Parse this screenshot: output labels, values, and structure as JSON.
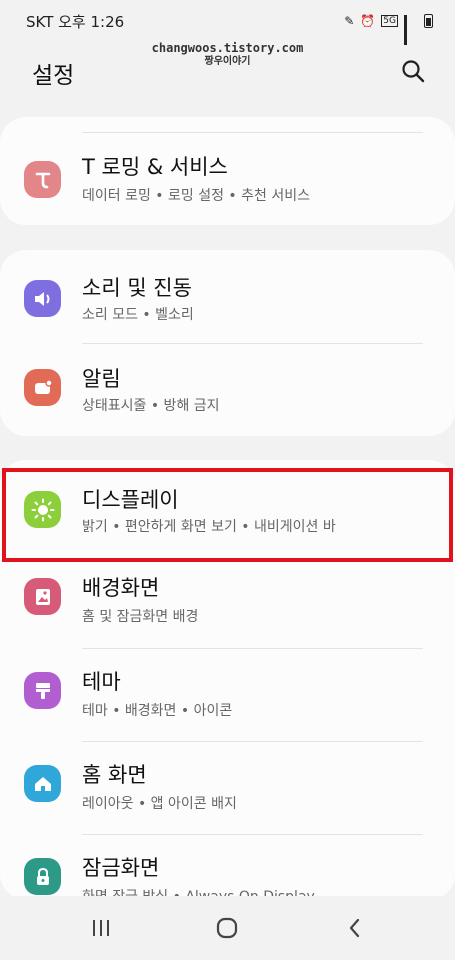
{
  "status": {
    "carrier_time": "SKT 오후 1:26",
    "network": "5G"
  },
  "watermark": {
    "line1": "changwoos.tistory.com",
    "line2": "짱우이야기"
  },
  "header": {
    "title": "설정",
    "search_icon": "search-icon"
  },
  "groups": [
    {
      "items": [
        {
          "label": "T 로밍 & 서비스",
          "sub": "데이터 로밍 • 로밍 설정 • 추천 서비스",
          "icon": "roaming-icon",
          "icon_color": "#e3868a"
        }
      ]
    },
    {
      "items": [
        {
          "label": "소리 및 진동",
          "sub": "소리 모드 • 벨소리",
          "icon": "speaker-icon",
          "icon_color": "#7d6fe0"
        },
        {
          "label": "알림",
          "sub": "상태표시줄 • 방해 금지",
          "icon": "notification-icon",
          "icon_color": "#e26b58"
        }
      ]
    },
    {
      "items": [
        {
          "label": "디스플레이",
          "sub": "밝기 • 편안하게 화면 보기 • 내비게이션 바",
          "icon": "brightness-icon",
          "icon_color": "#8ccf3a"
        },
        {
          "label": "배경화면",
          "sub": "홈 및 잠금화면 배경",
          "icon": "wallpaper-icon",
          "icon_color": "#d65b78"
        },
        {
          "label": "테마",
          "sub": "테마 • 배경화면 • 아이콘",
          "icon": "theme-icon",
          "icon_color": "#b15fd0"
        },
        {
          "label": "홈 화면",
          "sub": "레이아웃 • 앱 아이콘 배지",
          "icon": "home-icon",
          "icon_color": "#2fa7d8"
        },
        {
          "label": "잠금화면",
          "sub": "화면 잠금 방식 • Always On Display",
          "icon": "lock-icon",
          "icon_color": "#2c9a86"
        }
      ]
    }
  ],
  "highlight_color": "#e0121b",
  "nav": {
    "recents": "recents-icon",
    "home": "home-button-icon",
    "back": "back-icon"
  }
}
